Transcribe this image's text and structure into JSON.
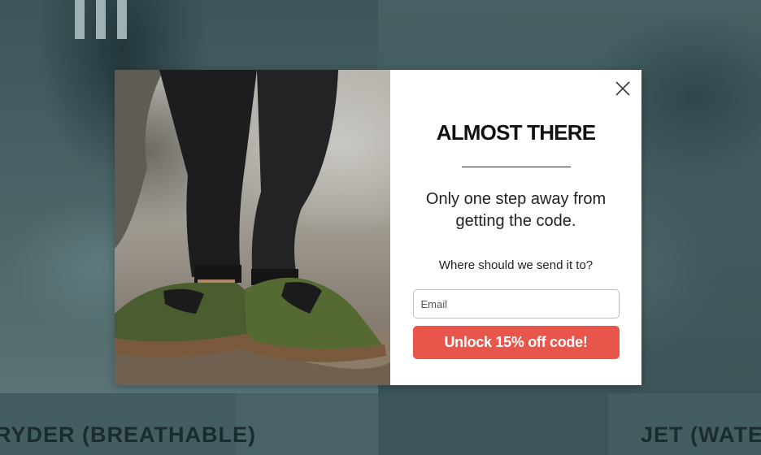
{
  "background": {
    "product_left_title": "RYDER (BREATHABLE)",
    "product_right_title": "JET (WATER"
  },
  "popup": {
    "headline": "ALMOST THERE",
    "subheadline": "Only one step away from getting the code.",
    "prompt": "Where should we send it to?",
    "email_placeholder": "Email",
    "email_value": "",
    "cta_label": "Unlock 15% off code!",
    "close_icon": "close-x-icon",
    "image": "hiker-shoes-photo"
  },
  "colors": {
    "cta_background": "#e8564b",
    "overlay_tint": "#3f5a5e",
    "shoe_green": "#4b5d2e"
  }
}
